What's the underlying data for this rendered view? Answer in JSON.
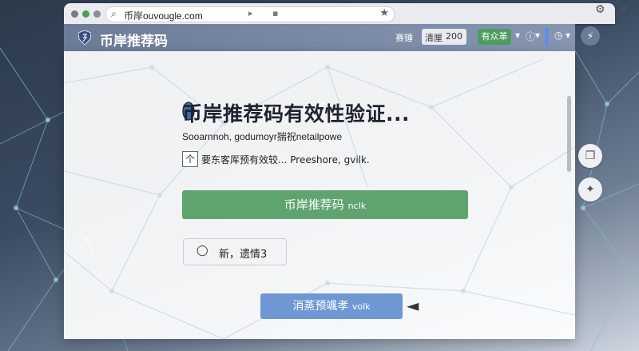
{
  "browser": {
    "url": "币岸ouvougle.com",
    "btn1": "▸",
    "btn2": "▪",
    "star": "★"
  },
  "app": {
    "title": "币岸推荐码",
    "header_label1": "赛锤",
    "header_label2": "清厘",
    "header_counter": "200",
    "header_green": "有众革"
  },
  "main": {
    "title": "币岸推荐码有效性验证...",
    "subtitle": "Sooarnnoh, godumoyr揣祝netailpowe",
    "checkbox_mark": "个",
    "checkbox_label": "要东客厍预有效较... Preeshore, gvilk.",
    "primary_button": "币岸推荐码",
    "primary_button_suffix": "ncIk",
    "comment_button": "新，遗情3",
    "secondary_button": "消蒸预颯孝",
    "secondary_button_suffix": "volk"
  },
  "colors": {
    "primary_green": "#5fa46f",
    "secondary_blue": "#6f97d4",
    "header": "#7888a4"
  },
  "icons": [
    "search-icon",
    "settings-icon",
    "close-icon",
    "logo-shield-icon",
    "comment-icon",
    "pin-icon",
    "lightning-icon",
    "arrow-left-icon"
  ]
}
